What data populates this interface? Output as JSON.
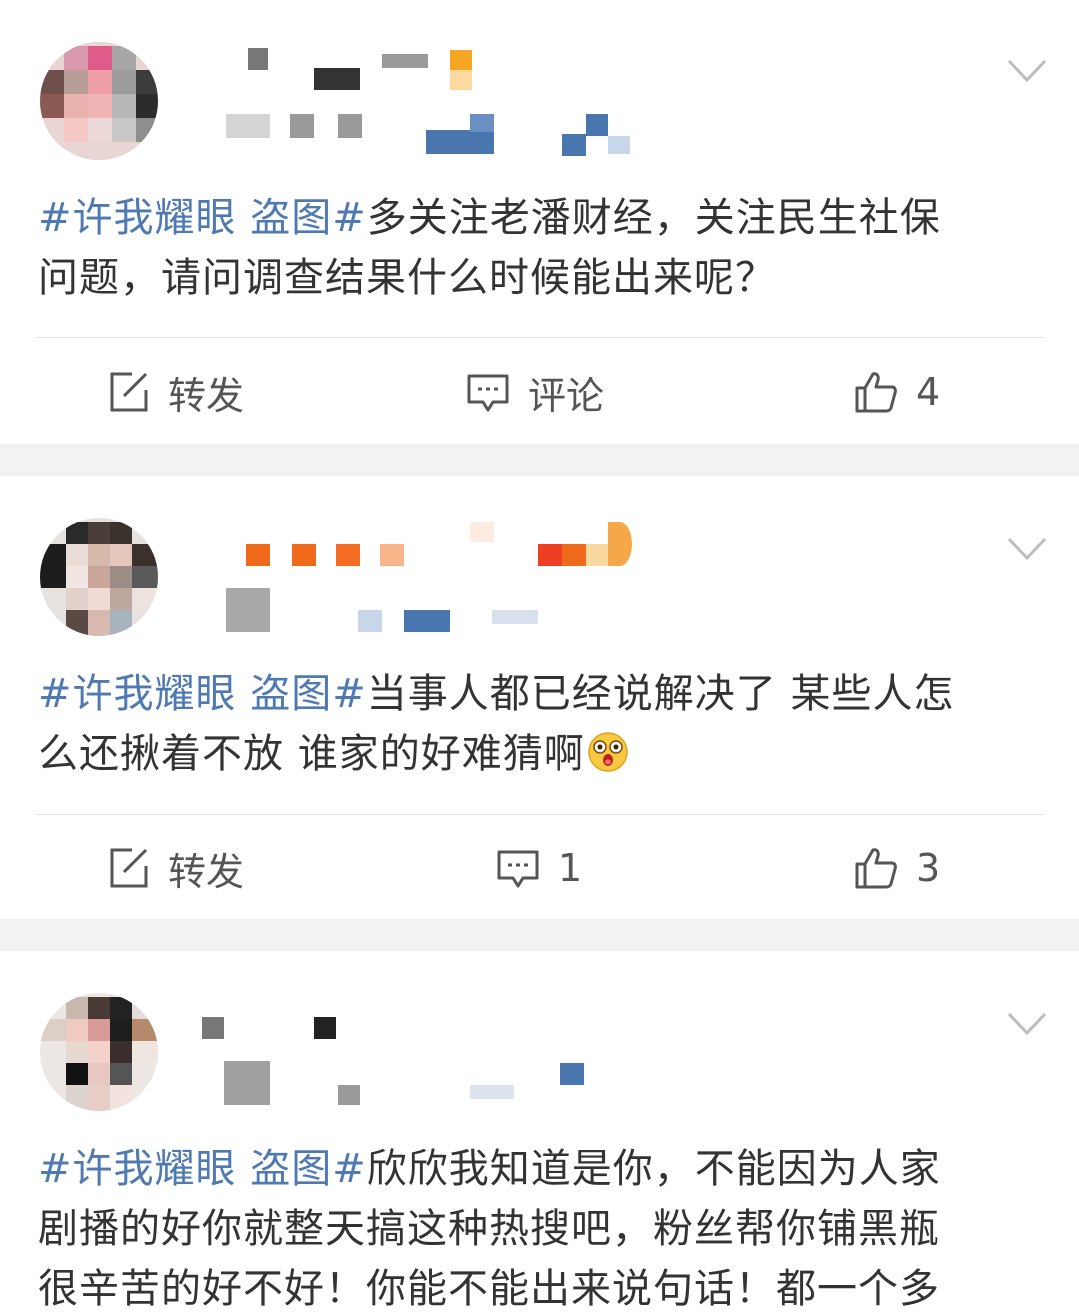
{
  "posts": [
    {
      "topic": "#许我耀眼 盗图#",
      "text_lines": [
        "多关注老潘财经，关注民生社保",
        "问题，请问调查结果什么时候能出来呢？"
      ],
      "actions": {
        "repost": "转发",
        "comment": "评论",
        "like": "4"
      }
    },
    {
      "topic": "#许我耀眼 盗图#",
      "text_lines": [
        "当事人都已经说解决了 某些人怎",
        "么还揪着不放 谁家的好难猜啊"
      ],
      "emoji": "shocked-face-emoji",
      "actions": {
        "repost": "转发",
        "comment": "1",
        "like": "3"
      }
    },
    {
      "topic": "#许我耀眼 盗图#",
      "text_lines": [
        "欣欣我知道是你，不能因为人家",
        "剧播的好你就整天搞这种热搜吧，粉丝帮你铺黑瓶",
        "很辛苦的好不好！你能不能出来说句话！都一个多"
      ],
      "actions": {}
    }
  ],
  "icons": {
    "repost": "repost-edit-icon",
    "comment": "comment-bubble-icon",
    "like": "thumbs-up-icon",
    "more": "chevron-down-icon"
  },
  "colors": {
    "topic": "#4f79b2",
    "text": "#333333",
    "action_text": "#555555",
    "background": "#f2f2f2"
  }
}
